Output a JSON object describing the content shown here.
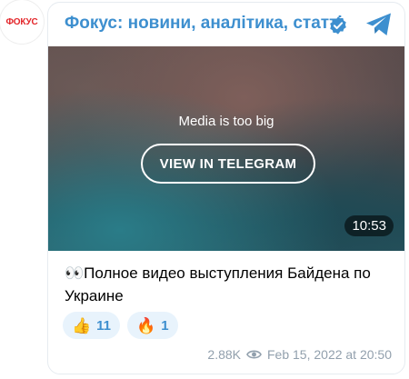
{
  "channel": {
    "avatar_text": "ФОКУС",
    "title": "Фокус: новини, аналітика, статті"
  },
  "media": {
    "note": "Media is too big",
    "view_button_label": "VIEW IN TELEGRAM",
    "duration": "10:53"
  },
  "message": {
    "text": "👀Полное видео выступления Байдена по Украине"
  },
  "reactions": [
    {
      "emoji": "👍",
      "count": "11"
    },
    {
      "emoji": "🔥",
      "count": "1"
    }
  ],
  "meta": {
    "views": "2.88K",
    "date": "Feb 15, 2022 at 20:50"
  },
  "colors": {
    "accent": "#3d8fcf",
    "brand_red": "#e3262a",
    "meta_gray": "#92a0ad",
    "reaction_bg": "#e8f3fc"
  },
  "icons": [
    "verified-badge-icon",
    "telegram-icon",
    "eye-icon"
  ]
}
